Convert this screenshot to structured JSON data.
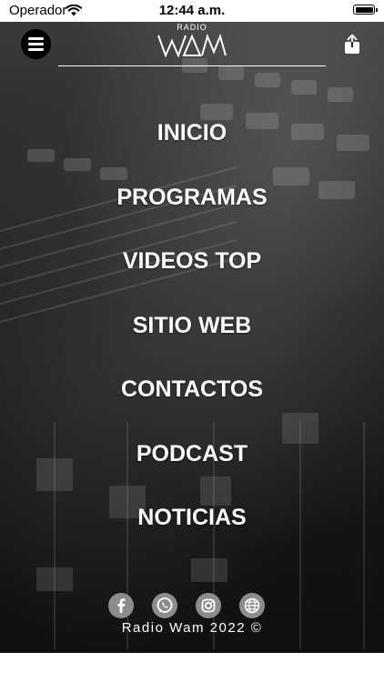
{
  "status_bar": {
    "carrier": "Operador",
    "time": "12:44 a.m."
  },
  "header": {
    "logo_small_text": "RADIO",
    "logo_text": "WAM",
    "menu_icon": "hamburger-menu-icon",
    "share_icon": "share-icon"
  },
  "nav": {
    "items": [
      {
        "label": "INICIO"
      },
      {
        "label": "PROGRAMAS"
      },
      {
        "label": "VIDEOS TOP"
      },
      {
        "label": "SITIO WEB"
      },
      {
        "label": "CONTACTOS"
      },
      {
        "label": "PODCAST"
      },
      {
        "label": "NOTICIAS"
      }
    ]
  },
  "footer": {
    "social_icons": [
      "facebook-icon",
      "whatsapp-icon",
      "instagram-icon",
      "globe-icon"
    ],
    "copyright": "Radio Wam 2022 ©"
  },
  "colors": {
    "text": "#ffffff",
    "social_circle": "#8c8c8c",
    "background_dark": "#1e1e1e"
  }
}
